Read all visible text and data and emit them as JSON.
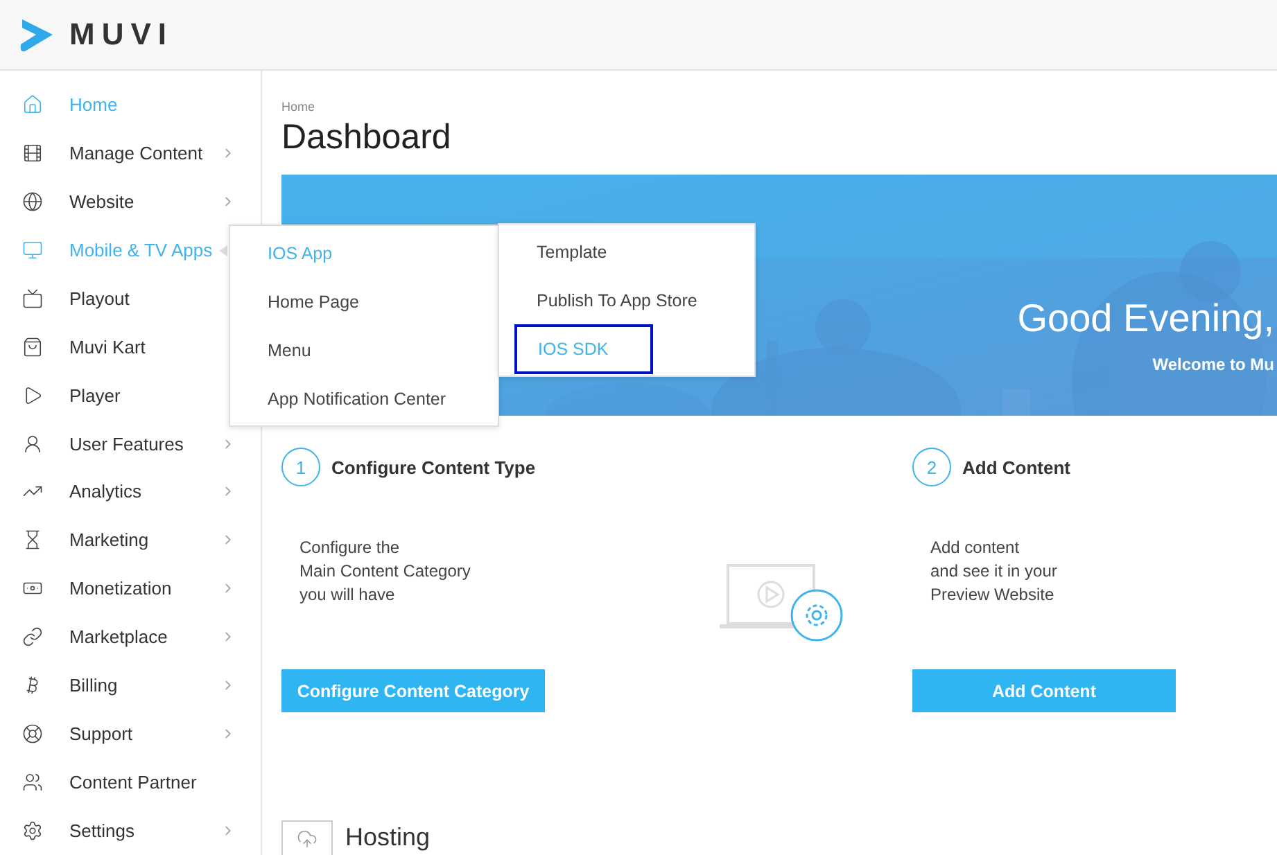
{
  "header": {
    "logo_text": "MUVI"
  },
  "sidebar": {
    "items": [
      {
        "label": "Home",
        "selected": true,
        "has_submenu": false
      },
      {
        "label": "Manage Content",
        "selected": false,
        "has_submenu": true,
        "expanded": false
      },
      {
        "label": "Website",
        "selected": false,
        "has_submenu": true,
        "expanded": false
      },
      {
        "label": "Mobile & TV Apps",
        "selected": true,
        "has_submenu": true,
        "expanded": true
      },
      {
        "label": "Playout",
        "selected": false,
        "has_submenu": false
      },
      {
        "label": "Muvi Kart",
        "selected": false,
        "has_submenu": false
      },
      {
        "label": "Player",
        "selected": false,
        "has_submenu": false
      },
      {
        "label": "User Features",
        "selected": false,
        "has_submenu": true,
        "expanded": false
      },
      {
        "label": "Analytics",
        "selected": false,
        "has_submenu": true,
        "expanded": false
      },
      {
        "label": "Marketing",
        "selected": false,
        "has_submenu": true,
        "expanded": false
      },
      {
        "label": "Monetization",
        "selected": false,
        "has_submenu": true,
        "expanded": false
      },
      {
        "label": "Marketplace",
        "selected": false,
        "has_submenu": true,
        "expanded": false
      },
      {
        "label": "Billing",
        "selected": false,
        "has_submenu": true,
        "expanded": false
      },
      {
        "label": "Support",
        "selected": false,
        "has_submenu": true,
        "expanded": false
      },
      {
        "label": "Content Partner",
        "selected": false,
        "has_submenu": false
      },
      {
        "label": "Settings",
        "selected": false,
        "has_submenu": true,
        "expanded": false
      }
    ]
  },
  "submenu": {
    "items": [
      {
        "label": "IOS App",
        "selected": true
      },
      {
        "label": "Home Page",
        "selected": false
      },
      {
        "label": "Menu",
        "selected": false
      },
      {
        "label": "App Notification Center",
        "selected": false
      }
    ]
  },
  "submenu_2": {
    "items": [
      {
        "label": "Template",
        "selected": false,
        "highlighted": false
      },
      {
        "label": "Publish To App Store",
        "selected": false,
        "highlighted": false
      },
      {
        "label": "IOS SDK",
        "selected": true,
        "highlighted": true
      }
    ]
  },
  "breadcrumb": "Home",
  "page_title": "Dashboard",
  "banner": {
    "kind": "picture",
    "greeting": "Good Evening,",
    "subtitle": "Welcome to Mu"
  },
  "steps": [
    {
      "number": "1",
      "title": "Configure Content Type",
      "description": [
        "Configure the",
        "Main Content Category",
        "you will have"
      ],
      "button": "Configure Content Category"
    },
    {
      "number": "2",
      "title": "Add Content",
      "description": [
        "Add content",
        "and see it in your",
        "Preview Website"
      ],
      "button": "Add Content"
    }
  ],
  "hosting": {
    "title": "Hosting"
  }
}
